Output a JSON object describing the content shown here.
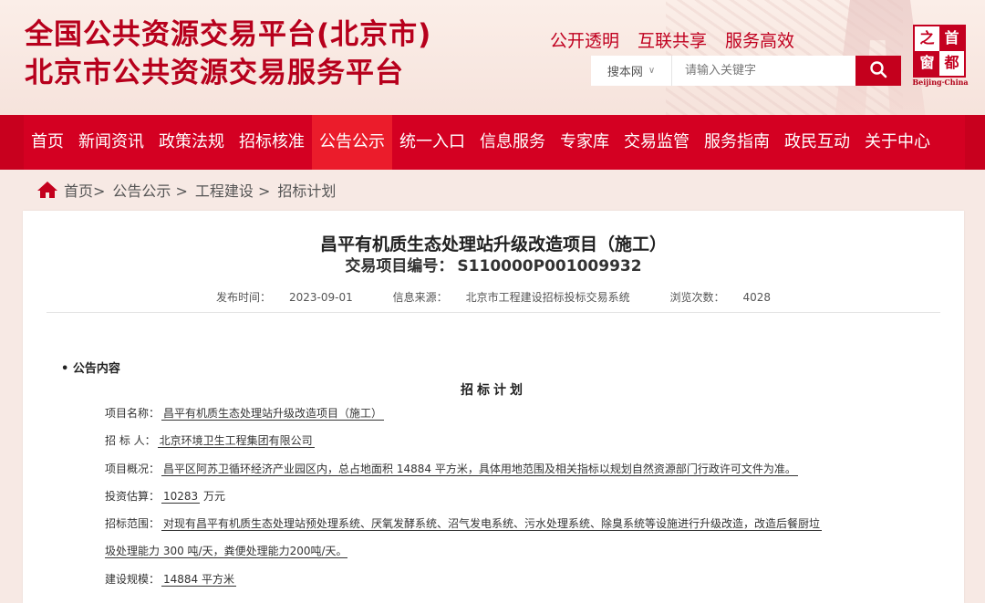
{
  "header": {
    "title_line1": "全国公共资源交易平台(北京市)",
    "title_line2": "北京市公共资源交易服务平台",
    "slogans": [
      "公开透明",
      "互联共享",
      "服务高效"
    ],
    "search": {
      "scope_label": "搜本网",
      "placeholder": "请输入关键字",
      "button_icon": "search-icon"
    },
    "logo": {
      "chars": [
        "之",
        "首",
        "窗",
        "都"
      ],
      "subtitle": "Beijing·China"
    }
  },
  "nav": {
    "items": [
      "首页",
      "新闻资讯",
      "政策法规",
      "招标核准",
      "公告公示",
      "统一入口",
      "信息服务",
      "专家库",
      "交易监管",
      "服务指南",
      "政民互动",
      "关于中心"
    ],
    "active_index": 4
  },
  "breadcrumb": {
    "home_icon": "home-icon",
    "items": [
      "首页>",
      "公告公示 >",
      "工程建设 >",
      "招标计划"
    ]
  },
  "document": {
    "title": "昌平有机质生态处理站升级改造项目（施工）",
    "code_label": "交易项目编号：",
    "code": "S110000P001009932",
    "publish_label": "发布时间：",
    "publish_date": "2023-09-01",
    "source_label": "信息来源：",
    "source": "北京市工程建设招标投标交易系统",
    "views_label": "浏览次数：",
    "views": "4028",
    "section_heading": "• 公告内容",
    "plan_title": "招标计划",
    "fields": {
      "name_label": "项目名称：",
      "name": "昌平有机质生态处理站升级改造项目（施工）",
      "bidder_label": "招 标 人：",
      "bidder": "北京环境卫生工程集团有限公司",
      "overview_label": "项目概况：",
      "overview": "昌平区阿苏卫循环经济产业园区内，总占地面积 14884 平方米，具体用地范围及相关指标以规划自然资源部门行政许可文件为准。",
      "investment_label": "投资估算：",
      "investment": "10283",
      "investment_unit": "万元",
      "scope_label": "招标范围：",
      "scope_line1": "对现有昌平有机质生态处理站预处理系统、厌氧发酵系统、沼气发电系统、污水处理系统、除臭系统等设施进行升级改造，改造后餐厨垃",
      "scope_line2": "圾处理能力 300 吨/天，粪便处理能力200吨/天。",
      "scale_label": "建设规模：",
      "scale": "14884 平方米"
    }
  }
}
